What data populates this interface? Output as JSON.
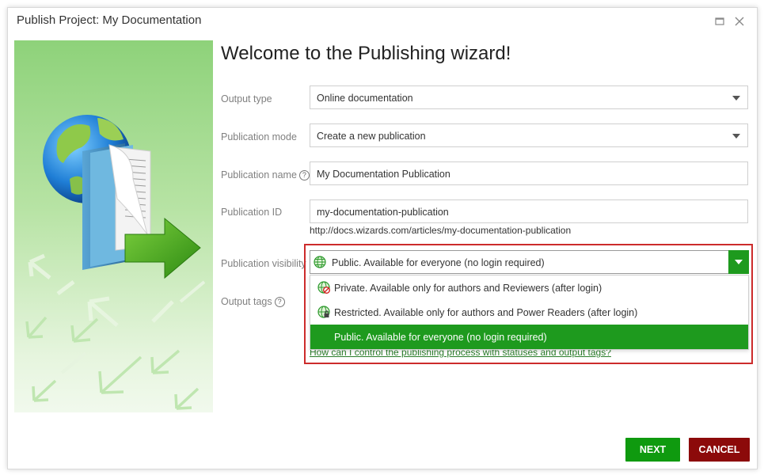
{
  "window": {
    "title": "Publish Project: My Documentation"
  },
  "heading": "Welcome to the Publishing wizard!",
  "fields": {
    "output_type": {
      "label": "Output type",
      "value": "Online documentation"
    },
    "publication_mode": {
      "label": "Publication mode",
      "value": "Create a new publication"
    },
    "publication_name": {
      "label": "Publication name",
      "value": "My Documentation Publication"
    },
    "publication_id": {
      "label": "Publication ID",
      "value": "my-documentation-publication",
      "url": "http://docs.wizards.com/articles/my-documentation-publication"
    },
    "publication_visibility": {
      "label": "Publication visibility",
      "value": "Public. Available for everyone (no login required)",
      "options": [
        {
          "label": "Private. Available only for authors and Reviewers (after login)",
          "icon": "globe-private-icon"
        },
        {
          "label": "Restricted. Available only for authors and Power Readers (after login)",
          "icon": "globe-locked-icon"
        },
        {
          "label": "Public. Available for everyone (no login required)",
          "icon": "globe-icon",
          "selected": true
        }
      ]
    },
    "output_tags": {
      "label": "Output tags"
    }
  },
  "help_link": "How can I control the publishing process with statuses and output tags?",
  "buttons": {
    "next": "NEXT",
    "cancel": "CANCEL"
  },
  "colors": {
    "accent_green": "#1e9a1e",
    "cancel_red": "#8c0a0a",
    "highlight_red": "#cc2b2b"
  }
}
